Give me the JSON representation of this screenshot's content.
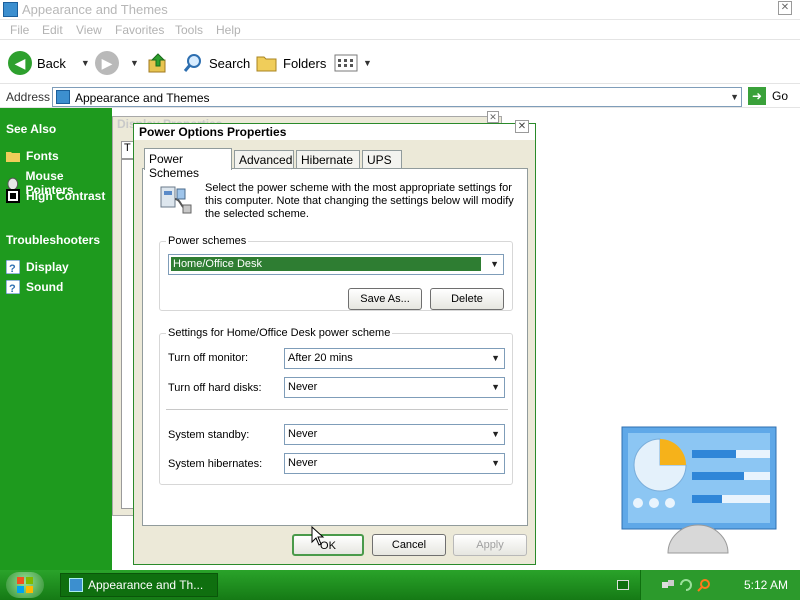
{
  "explorer": {
    "title": "Appearance and Themes",
    "menu": [
      "File",
      "Edit",
      "View",
      "Favorites",
      "Tools",
      "Help"
    ],
    "toolbar": {
      "back_label": "Back",
      "search_label": "Search",
      "folders_label": "Folders"
    },
    "address": {
      "label": "Address",
      "value": "Appearance and Themes",
      "go_label": "Go"
    }
  },
  "sidepane": {
    "see_also_heading": "See Also",
    "see_also": [
      "Fonts",
      "Mouse Pointers",
      "High Contrast"
    ],
    "troubleshooters_heading": "Troubleshooters",
    "troubleshooters": [
      "Display",
      "Sound"
    ]
  },
  "display_window": {
    "title": "Display Properties",
    "tab_fragment": "T"
  },
  "power_dialog": {
    "title": "Power Options Properties",
    "tabs": [
      "Power Schemes",
      "Advanced",
      "Hibernate",
      "UPS"
    ],
    "description": "Select the power scheme with the most appropriate settings for this computer. Note that changing the settings below will modify the selected scheme.",
    "schemes_group_label": "Power schemes",
    "selected_scheme": "Home/Office Desk",
    "save_as_label": "Save As...",
    "delete_label": "Delete",
    "settings_group_label": "Settings for Home/Office Desk power scheme",
    "settings": [
      {
        "label": "Turn off monitor:",
        "value": "After 20 mins"
      },
      {
        "label": "Turn off hard disks:",
        "value": "Never"
      },
      {
        "label": "System standby:",
        "value": "Never"
      },
      {
        "label": "System hibernates:",
        "value": "Never"
      }
    ],
    "ok_label": "OK",
    "cancel_label": "Cancel",
    "apply_label": "Apply"
  },
  "taskbar": {
    "task_label": "Appearance and Th...",
    "clock": "5:12 AM"
  },
  "colors": {
    "accent_green": "#1e9a1e",
    "selection_green": "#2e7d32",
    "taskbar_green": "#2aa32a"
  }
}
